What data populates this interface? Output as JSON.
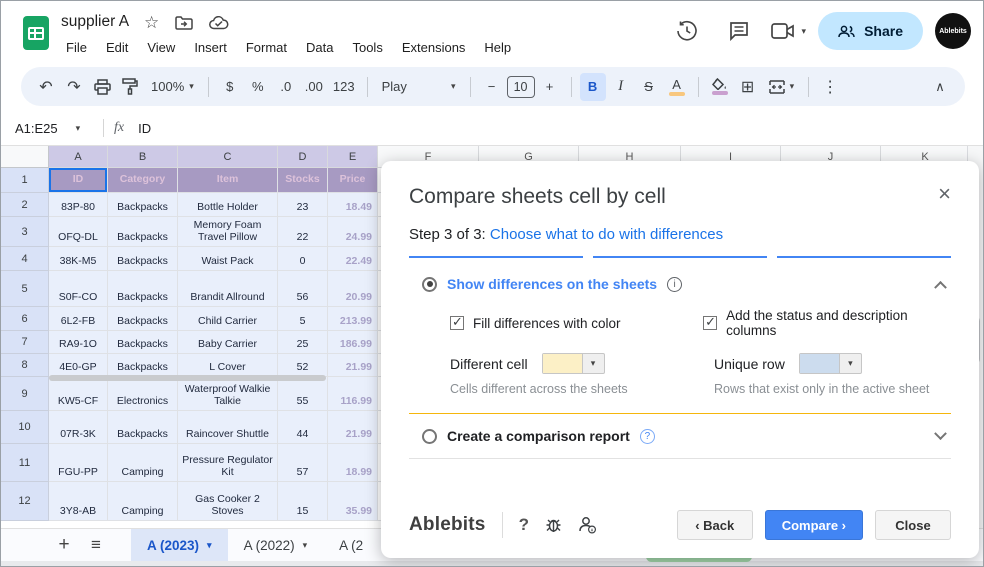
{
  "icons": {
    "caret": "▾",
    "close": "×",
    "more": "⋮",
    "add": "+",
    "menu": "≡",
    "undo": "↶",
    "redo": "↷",
    "borders": "⊞",
    "collapse": "∧",
    "star": "☆"
  },
  "titlebar": {
    "doc_title": "supplier A",
    "menu": [
      "File",
      "Edit",
      "View",
      "Insert",
      "Format",
      "Data",
      "Tools",
      "Extensions",
      "Help"
    ],
    "share_label": "Share",
    "avatar_label": "Ablebits"
  },
  "toolbar": {
    "zoom": "100%",
    "currency": "$",
    "percent": "%",
    "dec_decrease": ".0",
    "dec_increase": ".00",
    "more_formats": "123",
    "font_name": "Play",
    "size_minus": "−",
    "font_size": "10",
    "size_plus": "+",
    "bold": "B",
    "italic": "I",
    "strike": "S",
    "text_color": "A"
  },
  "formula_bar": {
    "range": "A1:E25",
    "fx": "fx",
    "value": "ID"
  },
  "sheet": {
    "col_letters": [
      "A",
      "B",
      "C",
      "D",
      "E",
      "F",
      "G",
      "H",
      "I",
      "J",
      "K"
    ],
    "header_row": [
      "ID",
      "Category",
      "Item",
      "Stocks",
      "Price"
    ],
    "rows": [
      [
        "83P-80",
        "Backpacks",
        "Bottle Holder",
        "23",
        "18.49"
      ],
      [
        "OFQ-DL",
        "Backpacks",
        "Memory Foam Travel Pillow",
        "22",
        "24.99"
      ],
      [
        "38K-M5",
        "Backpacks",
        "Waist Pack",
        "0",
        "22.49"
      ],
      [
        "S0F-CO",
        "Backpacks",
        "Brandit Allround",
        "56",
        "20.99"
      ],
      [
        "6L2-FB",
        "Backpacks",
        "Child Carrier",
        "5",
        "213.99"
      ],
      [
        "RA9-1O",
        "Backpacks",
        "Baby Carrier",
        "25",
        "186.99"
      ],
      [
        "4E0-GP",
        "Backpacks",
        "L Cover",
        "52",
        "21.99"
      ],
      [
        "KW5-CF",
        "Electronics",
        "Waterproof Walkie Talkie",
        "55",
        "116.99"
      ],
      [
        "07R-3K",
        "Backpacks",
        "Raincover Shuttle",
        "44",
        "21.99"
      ],
      [
        "FGU-PP",
        "Camping",
        "Pressure Regulator Kit",
        "57",
        "18.99"
      ],
      [
        "3Y8-AB",
        "Camping",
        "Gas Cooker 2 Stoves",
        "15",
        "35.99"
      ]
    ]
  },
  "tabs": {
    "active": "A (2023)",
    "tab2": "A (2022)",
    "tab3": "A (2"
  },
  "dialog": {
    "title": "Compare sheets cell by cell",
    "step_prefix": "Step 3 of 3:",
    "step_link": "Choose what to do with differences",
    "option_show": "Show differences on the sheets",
    "check_fill": "Fill differences with color",
    "check_add": "Add the status and description columns",
    "different_cell_label": "Different cell",
    "different_cell_caption": "Cells different across the sheets",
    "unique_row_label": "Unique row",
    "unique_row_caption": "Rows that exist only in the active sheet",
    "option_report": "Create a comparison report",
    "brand": "Ablebits",
    "help_q": "?",
    "back_label": "‹ Back",
    "compare_label": "Compare ›",
    "close_label": "Close",
    "colors": {
      "different_cell_swatch": "#fcf0c6",
      "unique_row_swatch": "#ccdcee"
    }
  }
}
